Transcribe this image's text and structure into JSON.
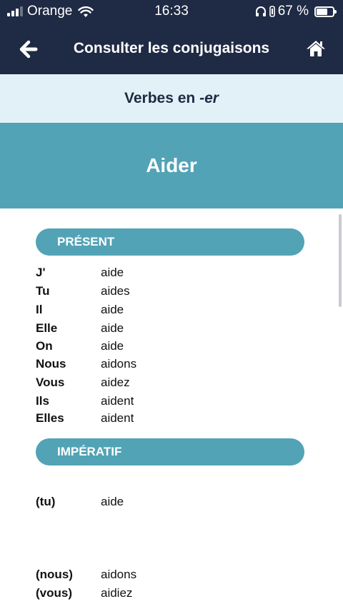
{
  "status": {
    "carrier": "Orange",
    "time": "16:33",
    "battery": "67 %",
    "battery_level": 0.67
  },
  "nav": {
    "title": "Consulter les conjugaisons",
    "back_icon": "arrow-left-icon",
    "home_icon": "home-icon"
  },
  "group": {
    "prefix": "Verbes en ",
    "suffix": "-er"
  },
  "verb": "Aider",
  "tenses": {
    "present": {
      "label": "PRÉSENT",
      "rows": [
        {
          "pronoun": "J'",
          "form": "aide"
        },
        {
          "pronoun": "Tu",
          "form": "aides"
        },
        {
          "pronoun": "Il",
          "form": "aide"
        },
        {
          "pronoun": "Elle",
          "form": "aide"
        },
        {
          "pronoun": "On",
          "form": "aide"
        },
        {
          "pronoun": "Nous",
          "form": "aidons"
        },
        {
          "pronoun": "Vous",
          "form": "aidez"
        },
        {
          "pronoun": "Ils",
          "form": "aident"
        },
        {
          "pronoun": "Elles",
          "form": "aident"
        }
      ]
    },
    "imperatif": {
      "label": "IMPÉRATIF",
      "rows": [
        {
          "pronoun": "(tu)",
          "form": "aide"
        },
        {
          "pronoun": "(nous)",
          "form": "aidons"
        },
        {
          "pronoun": "(vous)",
          "form": "aidiez"
        }
      ]
    }
  }
}
